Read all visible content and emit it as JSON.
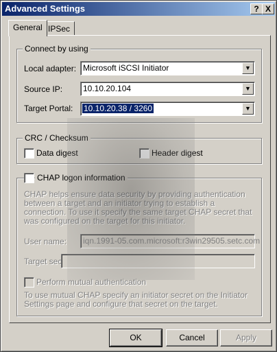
{
  "window": {
    "title": "Advanced Settings",
    "help_glyph": "?",
    "close_glyph": "X"
  },
  "tabs": [
    {
      "label": "General",
      "active": true
    },
    {
      "label": "IPSec",
      "active": false
    }
  ],
  "connect": {
    "group_title": "Connect by using",
    "local_adapter": {
      "label": "Local adapter:",
      "value": "Microsoft iSCSI Initiator"
    },
    "source_ip": {
      "label": "Source IP:",
      "value": "10.10.20.104"
    },
    "target_portal": {
      "label": "Target Portal:",
      "value": "10.10.20.38 / 3260"
    }
  },
  "crc": {
    "group_title": "CRC / Checksum",
    "data_digest": "Data digest",
    "header_digest": "Header digest"
  },
  "chap": {
    "checkbox_label": "CHAP logon information",
    "description": "CHAP helps ensure data security by providing authentication between a target and an initiator trying to establish a connection. To use it specify the same target CHAP secret that was configured on the target for this initiator.",
    "user_name_label": "User name:",
    "user_name_value": "iqn.1991-05.com.microsoft:r3win29505.setc.com",
    "target_secret_label": "Target secret:",
    "target_secret_value": "",
    "mutual_label": "Perform mutual authentication",
    "mutual_description": "To use mutual CHAP specify an initiator secret on the Initiator Settings page and configure that secret on the target."
  },
  "buttons": {
    "ok": "OK",
    "cancel": "Cancel",
    "apply": "Apply"
  },
  "icons": {
    "dropdown": "chevron-down-icon"
  }
}
